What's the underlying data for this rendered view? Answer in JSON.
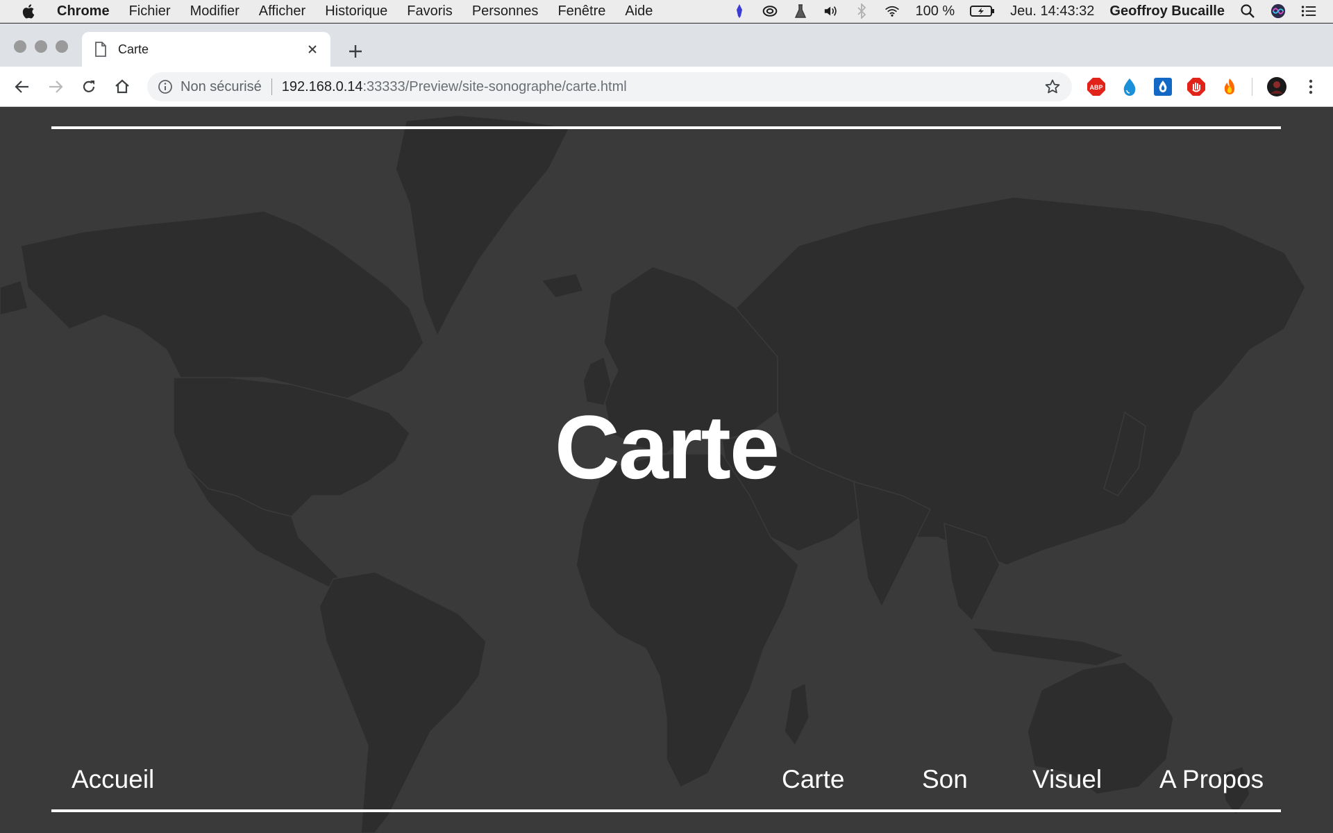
{
  "menubar": {
    "app": "Chrome",
    "items": [
      "Fichier",
      "Modifier",
      "Afficher",
      "Historique",
      "Favoris",
      "Personnes",
      "Fenêtre",
      "Aide"
    ],
    "battery": "100 %",
    "clock": "Jeu. 14:43:32",
    "user": "Geoffroy Bucaille"
  },
  "tab": {
    "title": "Carte"
  },
  "omnibox": {
    "security": "Non sécurisé",
    "host": "192.168.0.14",
    "path": ":33333/Preview/site-sonographe/carte.html"
  },
  "extensions": [
    {
      "name": "adblock-plus-icon",
      "label": "ABP",
      "color": "#e2231a"
    },
    {
      "name": "droplet-icon",
      "color": "#1b8fd8"
    },
    {
      "name": "raindrop-icon",
      "color": "#1268c4"
    },
    {
      "name": "stop-hand-icon",
      "color": "#e2231a"
    },
    {
      "name": "fire-icon",
      "color": "#ff6a00"
    }
  ],
  "page": {
    "heading": "Carte",
    "nav_home": "Accueil",
    "nav_items": [
      "Carte",
      "Son",
      "Visuel",
      "A Propos"
    ]
  },
  "colors": {
    "background": "#3a3a3a",
    "land": "#2d2d2d",
    "text": "#ffffff"
  }
}
